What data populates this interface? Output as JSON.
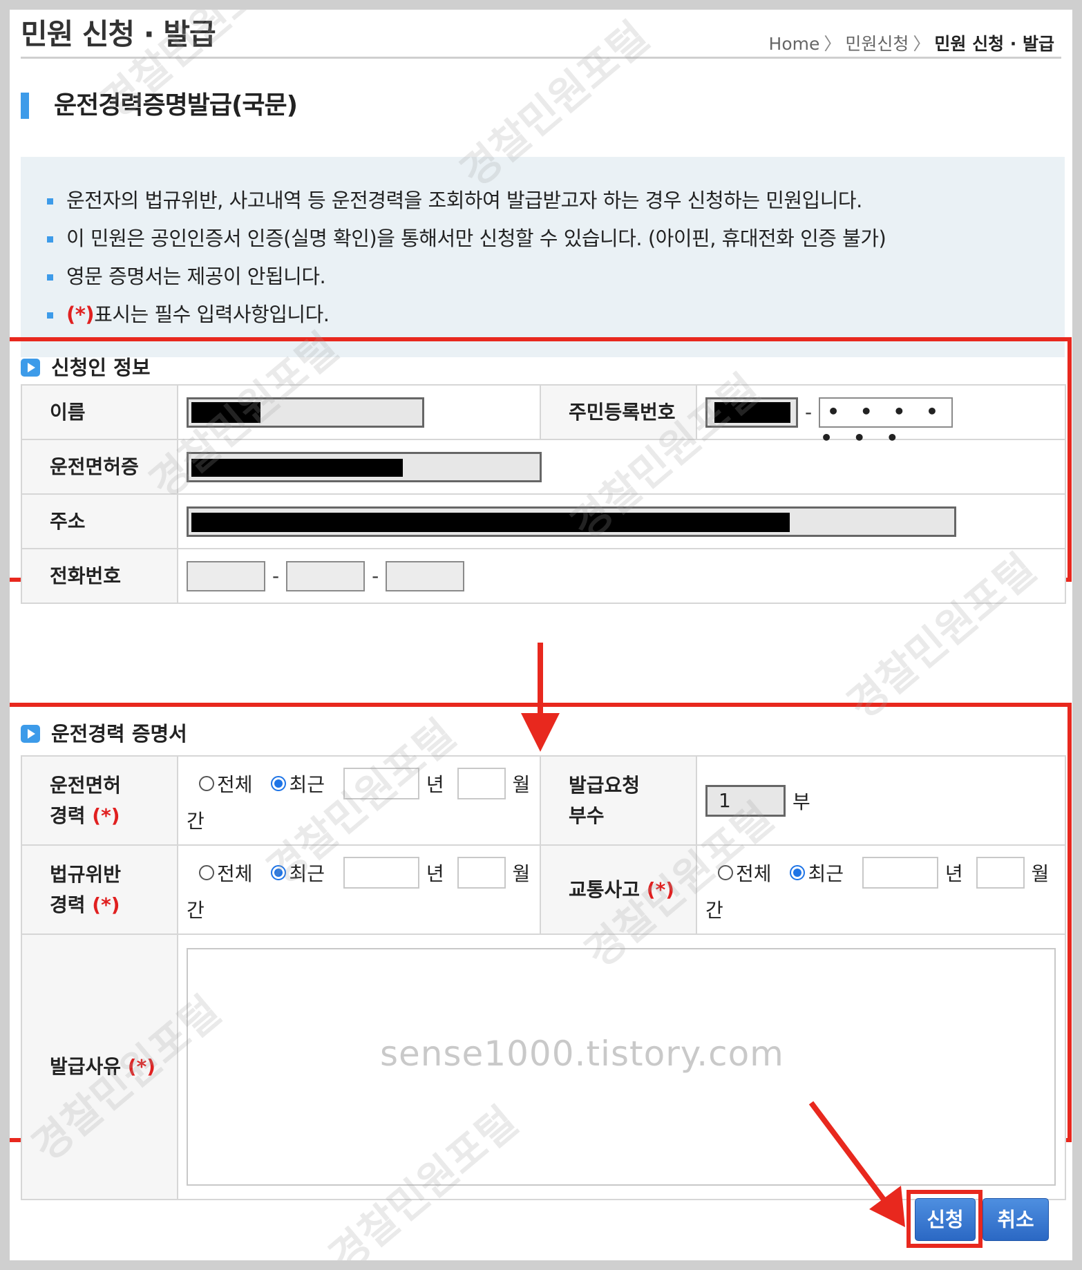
{
  "header": {
    "title": "민원 신청 · 발급",
    "breadcrumb": [
      "Home",
      "민원신청",
      "민원 신청 · 발급"
    ]
  },
  "section_title": "운전경력증명발급(국문)",
  "notices": [
    "운전자의 법규위반, 사고내역 등 운전경력을 조회하여 발급받고자 하는 경우 신청하는 민원입니다.",
    "이 민원은 공인인증서 인증(실명 확인)을 통해서만 신청할 수 있습니다. (아이핀, 휴대전화 인증 불가)",
    "영문 증명서는 제공이 안됩니다."
  ],
  "required_notice": {
    "mark": "(*)",
    "text": "표시는 필수 입력사항입니다."
  },
  "applicant": {
    "group_title": "신청인 정보",
    "name_label": "이름",
    "rrn_label": "주민등록번호",
    "rrn_dash": "-",
    "rrn_back": "• • • • • • •",
    "license_label": "운전면허증",
    "address_label": "주소",
    "phone_label": "전화번호",
    "phone_dash": "-"
  },
  "certificate": {
    "group_title": "운전경력 증명서",
    "req_mark": "(*)",
    "career_label_1": "운전면허",
    "career_label_2": "경력",
    "violation_label_1": "법규위반",
    "violation_label_2": "경력",
    "accident_label": "교통사고",
    "copies_label_1": "발급요청",
    "copies_label_2": "부수",
    "copies_value": "1",
    "copies_unit": "부",
    "reason_label": "발급사유",
    "radio_all": "전체",
    "radio_recent": "최근",
    "unit_year": "년",
    "unit_month": "월",
    "unit_period": "간"
  },
  "watermark": {
    "blog": "sense1000.tistory.com",
    "stamp": "경찰민원포털"
  },
  "buttons": {
    "apply": "신청",
    "cancel": "취소"
  },
  "colors": {
    "accent": "#3d9be9",
    "highlight": "#e8281e",
    "required": "#e02020",
    "button": "#2b68c4"
  }
}
